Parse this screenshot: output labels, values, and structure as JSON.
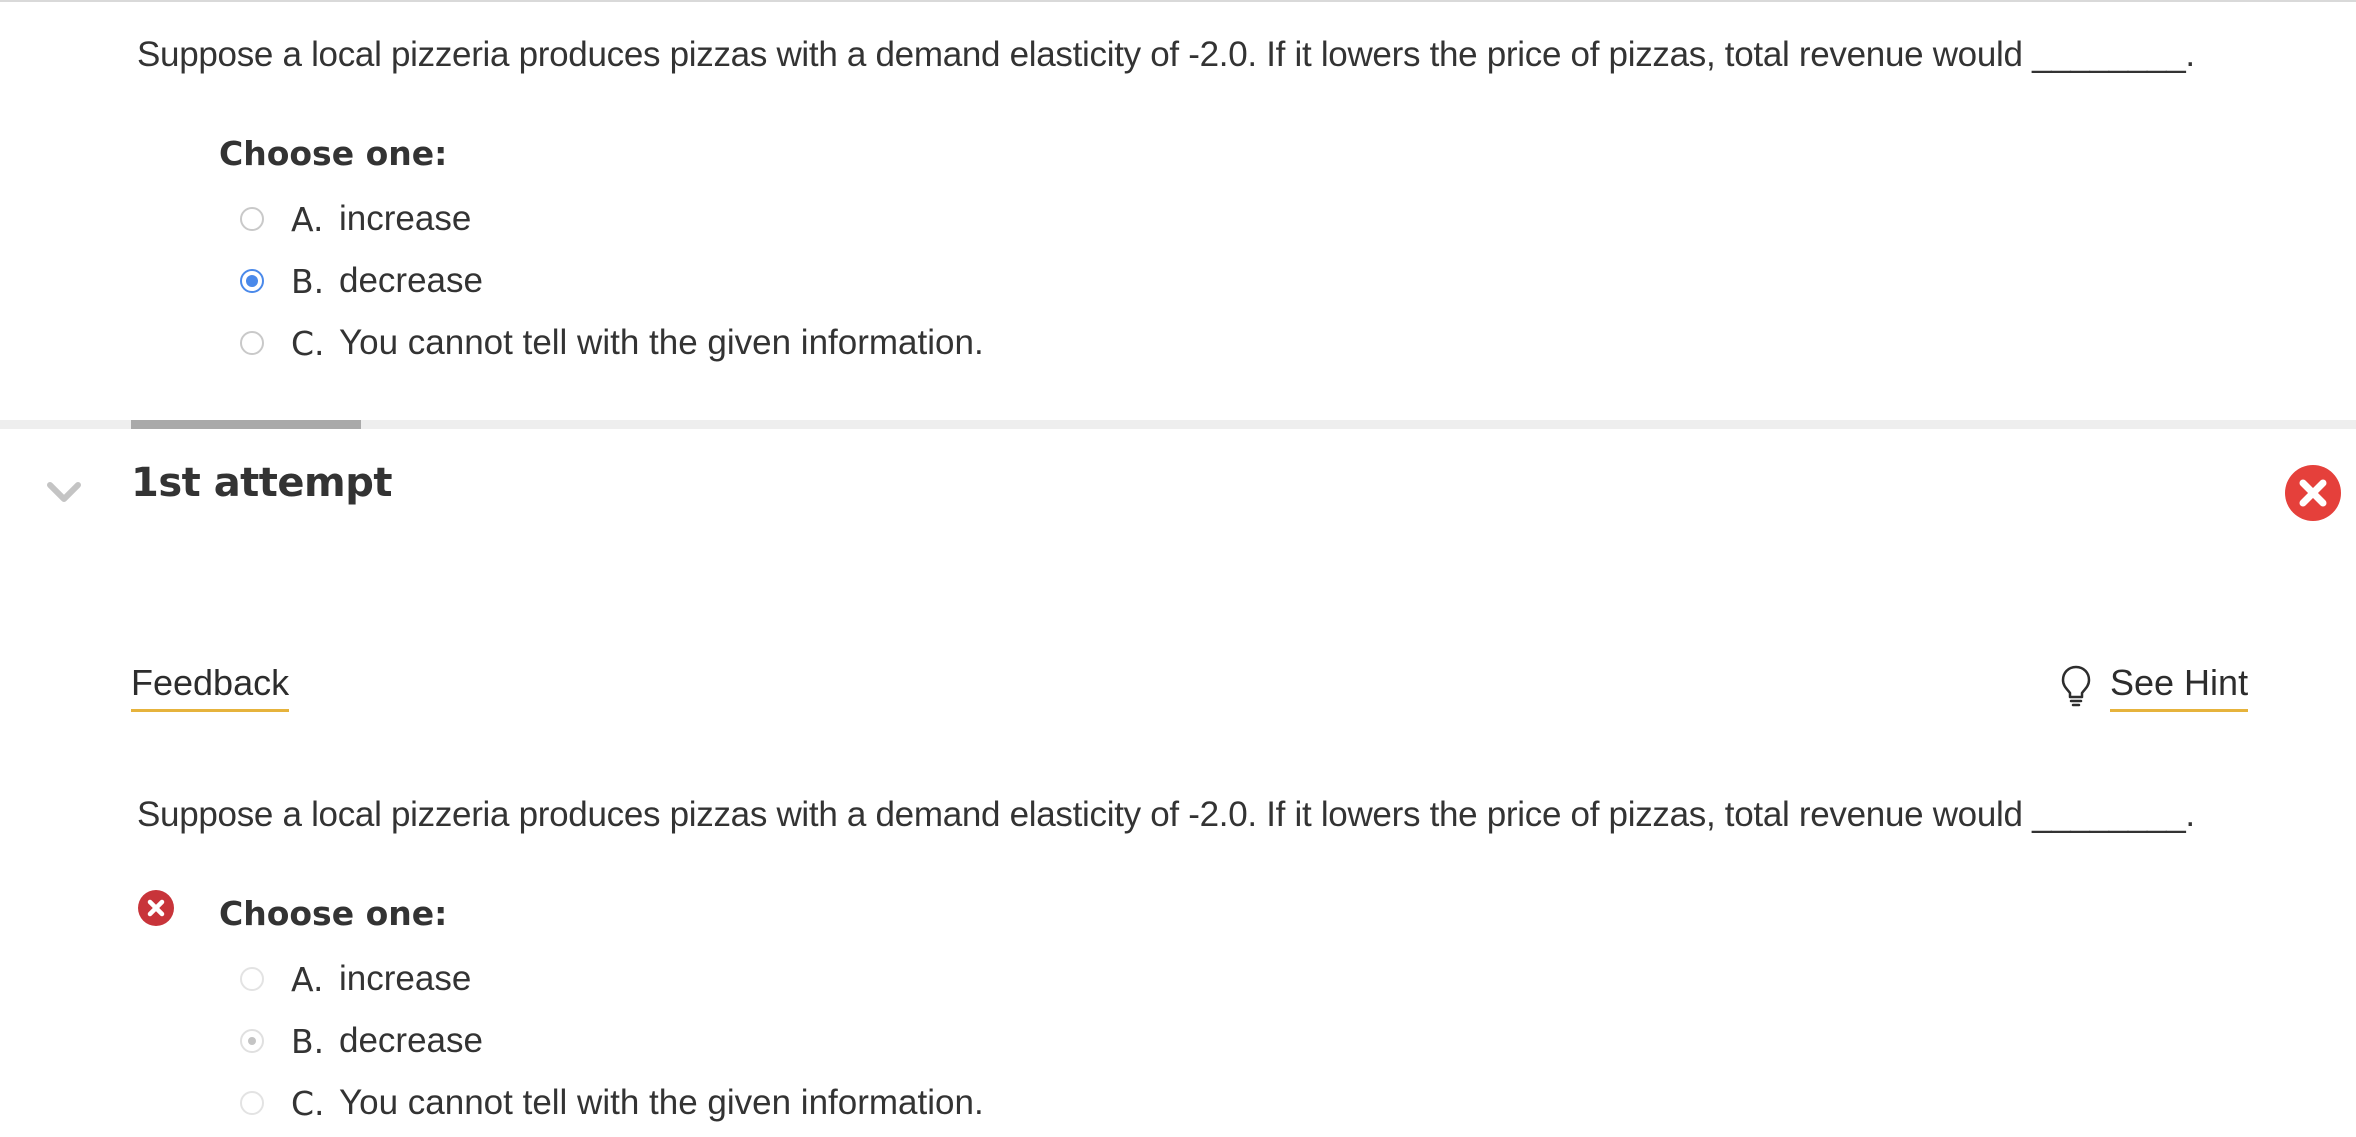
{
  "question_top": {
    "text": "Suppose a local pizzeria produces pizzas with a demand elasticity of -2.0. If it lowers the price of pizzas, total revenue would ________.",
    "choose_label": "Choose one:",
    "options": [
      {
        "letter": "A.",
        "text": "increase",
        "selected": false
      },
      {
        "letter": "B.",
        "text": "decrease",
        "selected": true
      },
      {
        "letter": "C.",
        "text": "You cannot tell with the given information.",
        "selected": false
      }
    ]
  },
  "attempt": {
    "title": "1st attempt",
    "status": "incorrect",
    "status_color": "#e5403b",
    "feedback_label": "Feedback",
    "hint_label": "See Hint",
    "accent_color": "#e6b33c",
    "question": {
      "text": "Suppose a local pizzeria produces pizzas with a demand elasticity of -2.0. If it lowers the price of pizzas, total revenue would ________.",
      "choose_label": "Choose one:",
      "options": [
        {
          "letter": "A.",
          "text": "increase",
          "selected": false
        },
        {
          "letter": "B.",
          "text": "decrease",
          "selected": true
        },
        {
          "letter": "C.",
          "text": "You cannot tell with the given information.",
          "selected": false
        }
      ]
    }
  },
  "icons": {
    "chevron": "chevron-down-icon",
    "incorrect": "x-circle-icon",
    "hint": "lightbulb-icon"
  },
  "colors": {
    "radio_selected": "#4a89ea",
    "incorrect_dark": "#c8343a",
    "divider_accent": "#a9a9a9"
  }
}
